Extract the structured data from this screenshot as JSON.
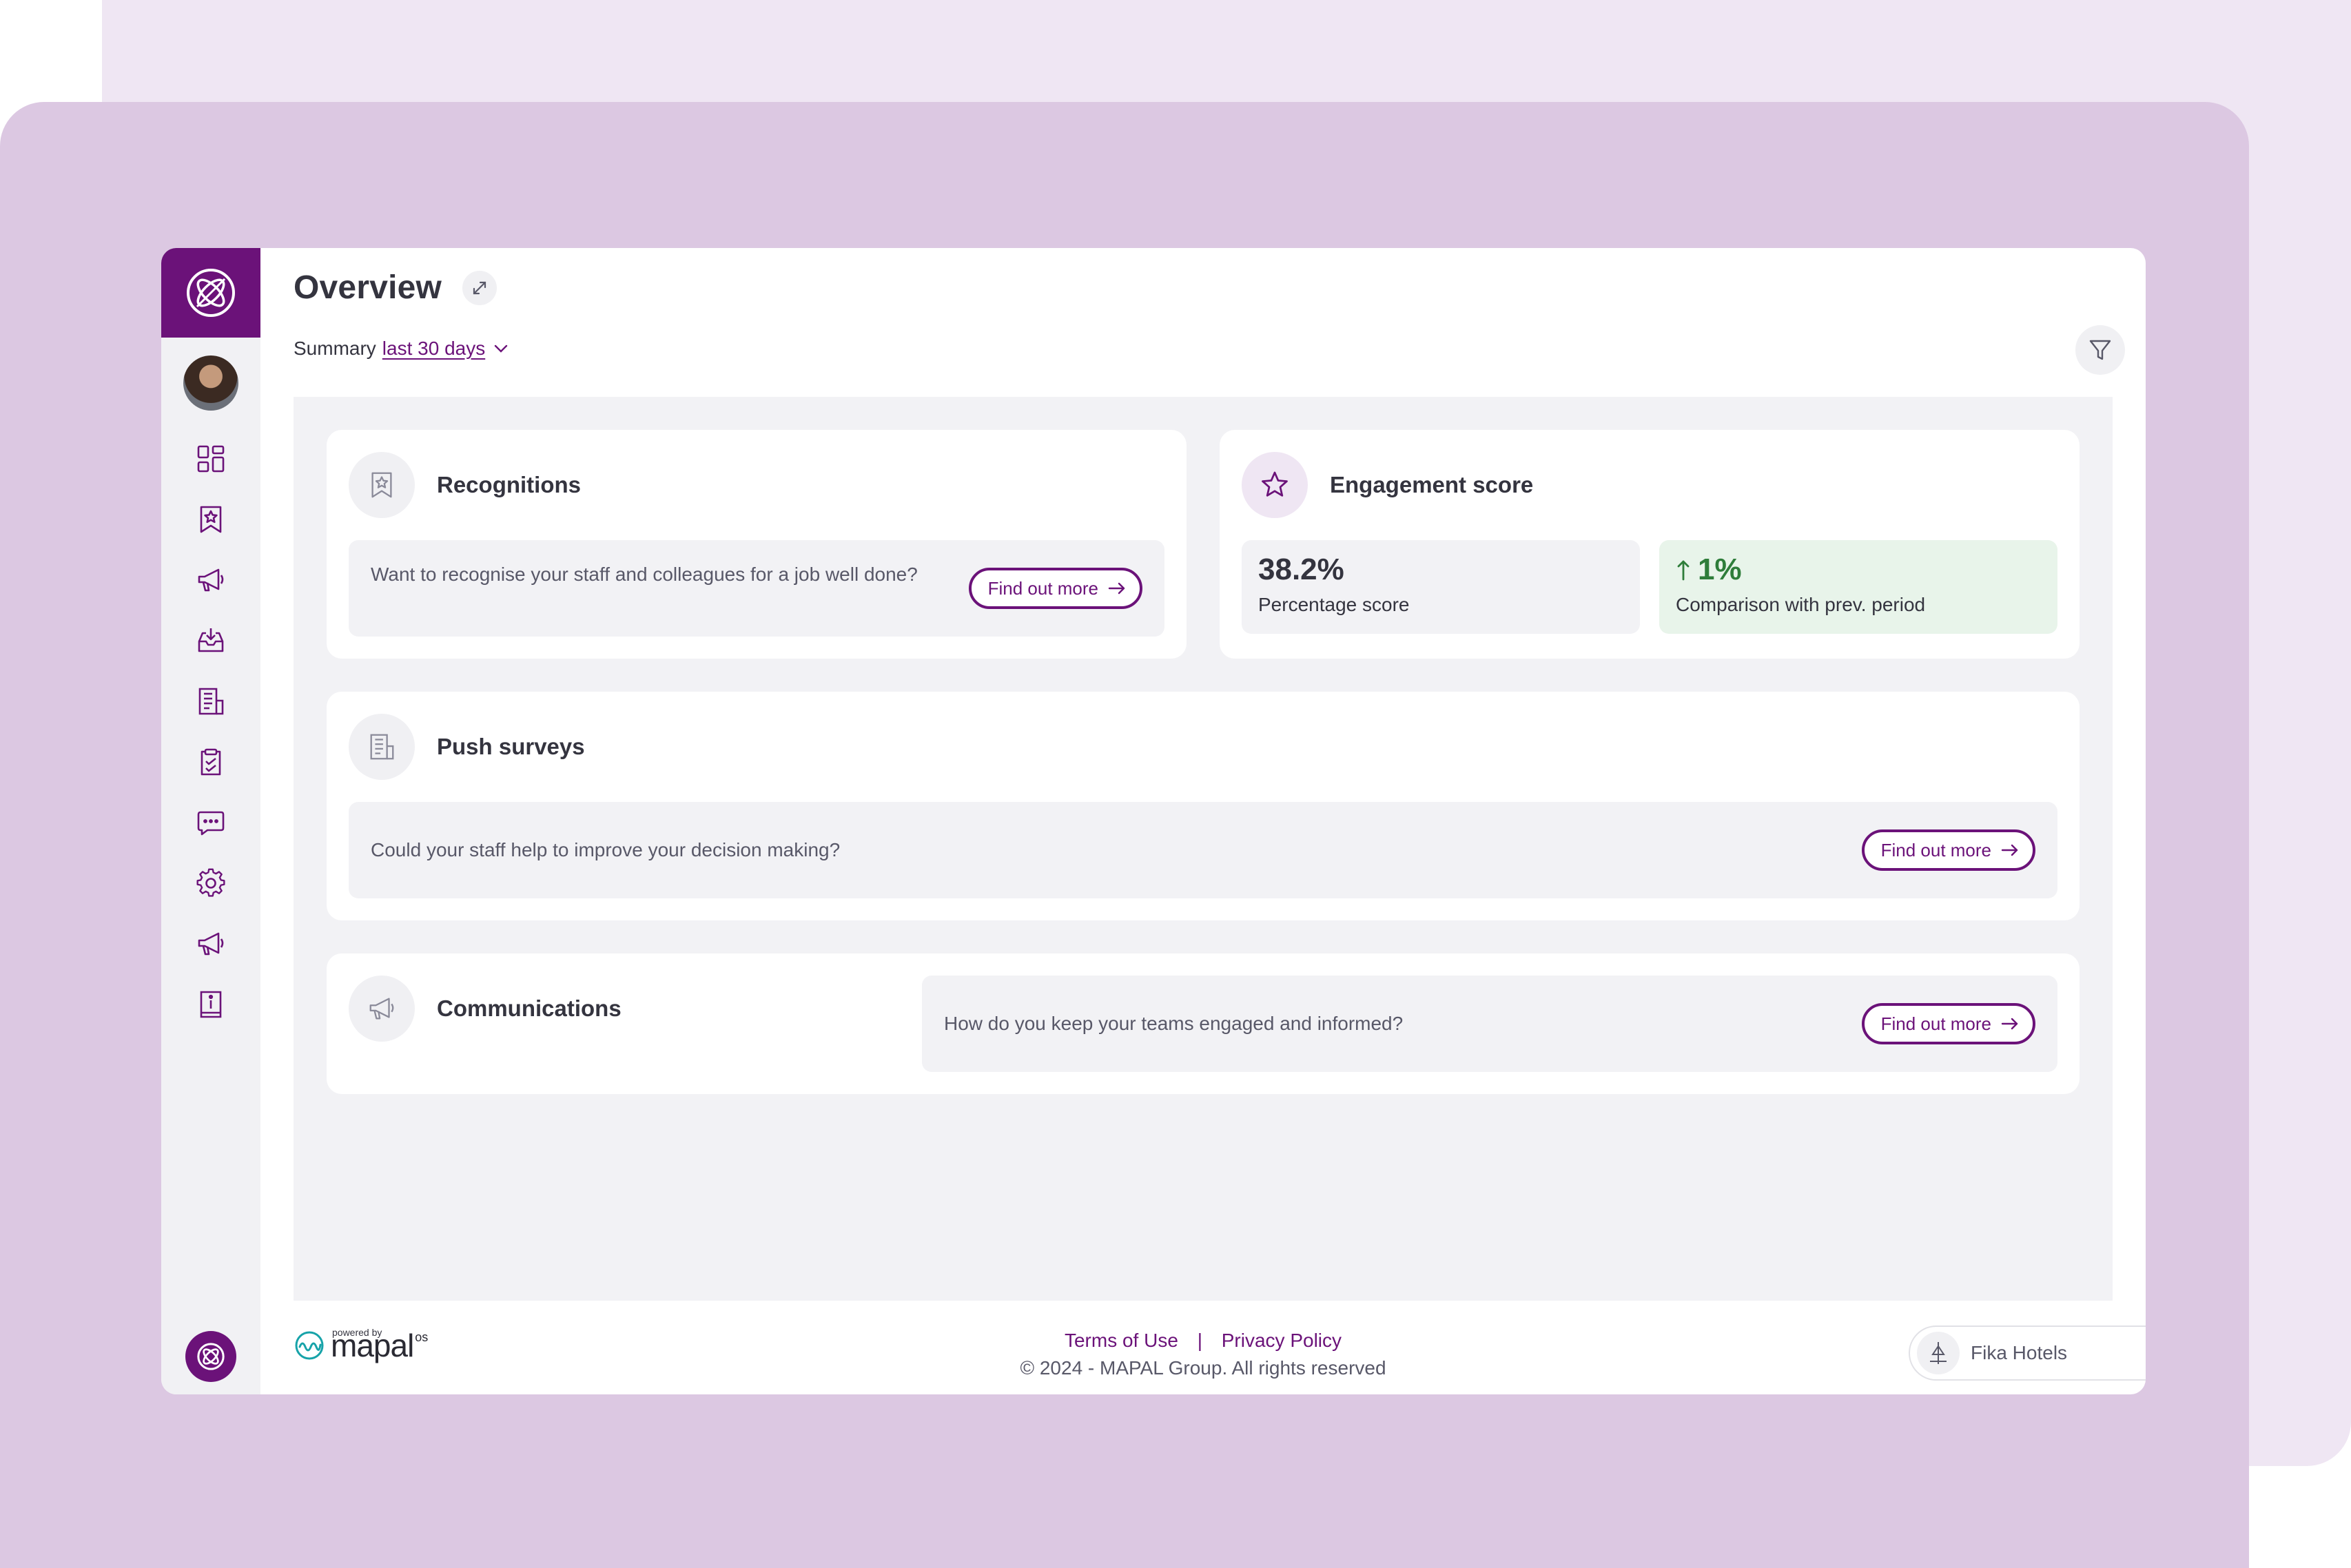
{
  "page": {
    "title": "Overview"
  },
  "summary": {
    "label": "Summary",
    "period": "last 30 days"
  },
  "sidebar": {
    "items": [
      {
        "icon": "dashboard-icon"
      },
      {
        "icon": "bookmark-star-icon"
      },
      {
        "icon": "megaphone-icon"
      },
      {
        "icon": "inbox-download-icon"
      },
      {
        "icon": "survey-form-icon"
      },
      {
        "icon": "clipboard-check-icon"
      },
      {
        "icon": "chat-bubble-icon"
      },
      {
        "icon": "gear-icon"
      },
      {
        "icon": "megaphone-icon"
      },
      {
        "icon": "info-book-icon"
      }
    ]
  },
  "cards": {
    "recognitions": {
      "title": "Recognitions",
      "text": "Want to recognise your staff and colleagues for a job well done?",
      "button": "Find out more"
    },
    "engagement": {
      "title": "Engagement score",
      "score_value": "38.2%",
      "score_label": "Percentage score",
      "comparison_value": "1%",
      "comparison_label": "Comparison with prev. period"
    },
    "push_surveys": {
      "title": "Push surveys",
      "text": "Could your staff help to improve your decision making?",
      "button": "Find out more"
    },
    "communications": {
      "title": "Communications",
      "text": "How do you keep your teams engaged and informed?",
      "button": "Find out more"
    }
  },
  "footer": {
    "powered_by": "powered by",
    "brand": "mapal",
    "brand_suffix": "os",
    "terms": "Terms of Use",
    "separator": "|",
    "privacy": "Privacy Policy",
    "copyright": "© 2024 - MAPAL Group. All rights reserved",
    "organization": "Fika Hotels"
  },
  "colors": {
    "brand_purple": "#6b1279",
    "success_green": "#2e7d3a",
    "comparison_bg": "#e8f4ea",
    "panel_bg": "#f2f2f5"
  }
}
